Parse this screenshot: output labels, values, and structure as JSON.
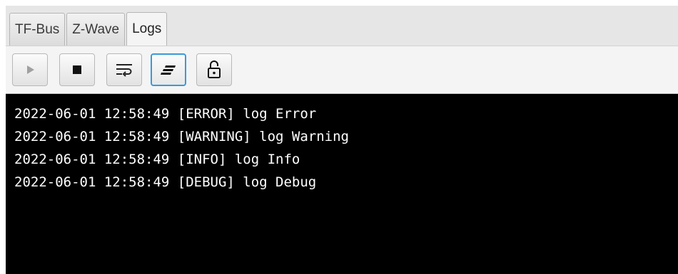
{
  "tabs": [
    {
      "label": "TF-Bus",
      "selected": false
    },
    {
      "label": "Z-Wave",
      "selected": false
    },
    {
      "label": "Logs",
      "selected": true
    }
  ],
  "toolbar": {
    "buttons": [
      {
        "icon": "play-icon",
        "enabled": false
      },
      {
        "icon": "stop-icon",
        "enabled": true
      },
      {
        "icon": "wrap-lines-icon",
        "enabled": true
      },
      {
        "icon": "align-text-icon",
        "enabled": true,
        "focused": true
      },
      {
        "icon": "unlocked-padlock-icon",
        "enabled": true
      }
    ]
  },
  "log": {
    "lines": [
      "2022-06-01 12:58:49 [ERROR] log Error",
      "2022-06-01 12:58:49 [WARNING] log Warning",
      "2022-06-01 12:58:49 [INFO] log Info",
      "2022-06-01 12:58:49 [DEBUG] log Debug"
    ]
  },
  "colors": {
    "console_background": "#000000",
    "console_text": "#ffffff",
    "focus_accent": "#3a9ad9",
    "disabled_icon": "#a0a0a0"
  }
}
